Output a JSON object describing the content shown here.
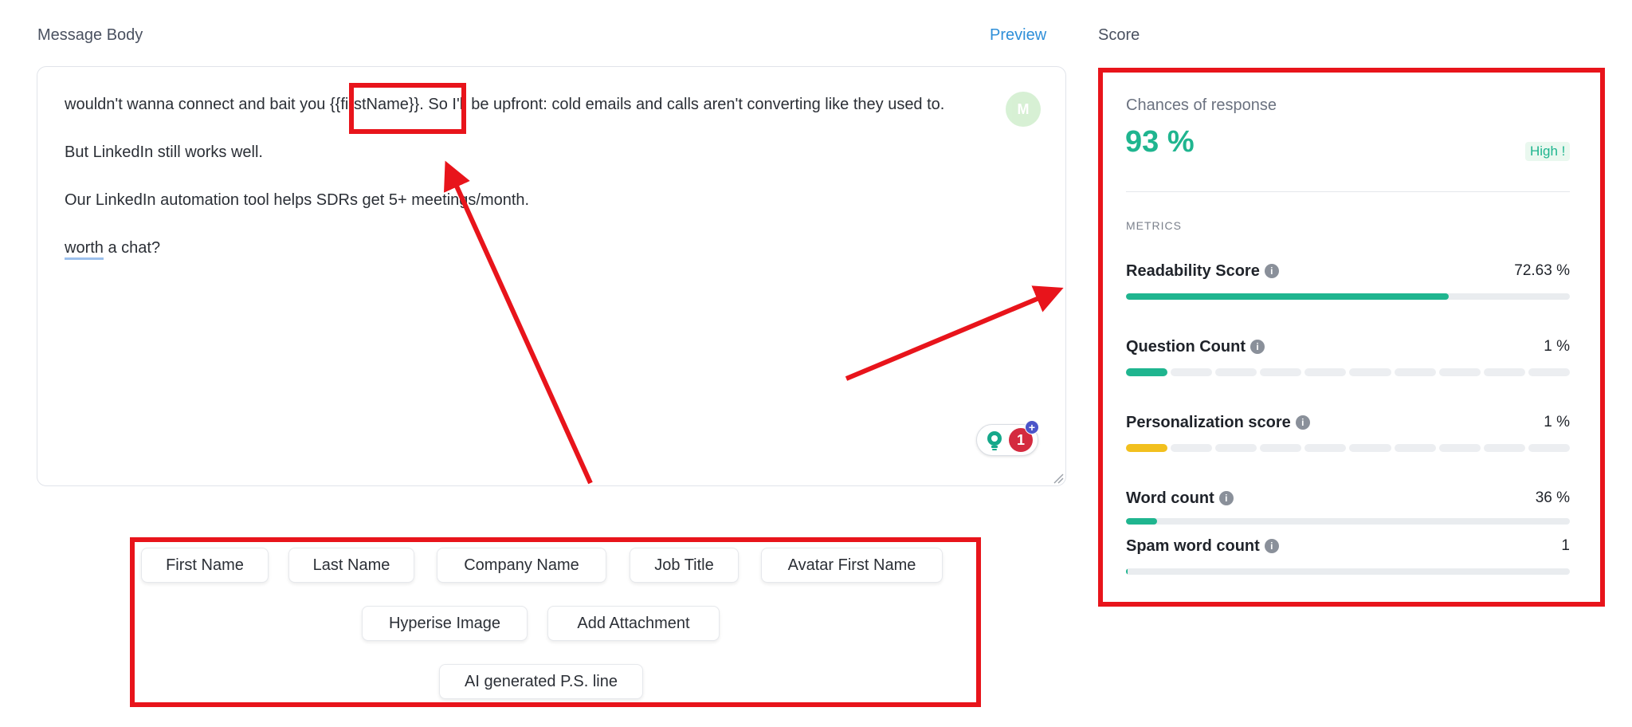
{
  "header": {
    "message_body_label": "Message Body",
    "preview_label": "Preview",
    "score_label": "Score"
  },
  "editor": {
    "line1_before": "wouldn't wanna connect and bait you ",
    "line1_variable": "{{firstName}}",
    "line1_after": ". So I'll be upfront: cold emails and calls aren't converting like they used to.",
    "line2": "But LinkedIn still works well.",
    "line3": "Our LinkedIn automation tool helps SDRs get 5+ meetings/month.",
    "line4_underlined": "worth",
    "line4_rest": " a chat?",
    "avatar_initial": "M",
    "grammar_issue_count": "1"
  },
  "variables": {
    "first_name": "First Name",
    "last_name": "Last Name",
    "company_name": "Company Name",
    "job_title": "Job Title",
    "avatar_first_name": "Avatar First Name",
    "hyperise_image": "Hyperise Image",
    "add_attachment": "Add Attachment",
    "ai_ps_line": "AI generated P.S. line"
  },
  "score": {
    "chances_title": "Chances of response",
    "chances_value": "93 %",
    "chances_badge": "High !",
    "metrics_heading": "METRICS",
    "metrics": [
      {
        "name": "Readability Score",
        "value": "72.63 %",
        "fraction": 0.7263,
        "color": "#1fb58f",
        "style": "continuous"
      },
      {
        "name": "Question Count",
        "value": "1 %",
        "filled_segments": 1,
        "segments": 10,
        "color": "#1fb58f",
        "style": "segmented"
      },
      {
        "name": "Personalization score",
        "value": "1 %",
        "filled_segments": 1,
        "segments": 10,
        "color": "#f2c01e",
        "style": "segmented"
      },
      {
        "name": "Word count",
        "value": "36 %",
        "fraction": 0.07,
        "color": "#1fb58f",
        "style": "continuous"
      },
      {
        "name": "Spam word count",
        "value": "1",
        "fraction": 0.003,
        "color": "#1fb58f",
        "style": "continuous"
      }
    ]
  },
  "colors": {
    "accent_green": "#1fb58f",
    "link_blue": "#2f8fd8",
    "annotation_red": "#e8141b"
  }
}
